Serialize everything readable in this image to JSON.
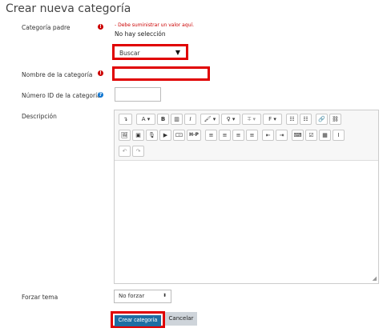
{
  "page": {
    "title": "Crear nueva categoría"
  },
  "form": {
    "parent": {
      "label": "Categoría padre",
      "error": "- Debe suministrar un valor aquí.",
      "current": "No hay selección",
      "search_value": "Buscar"
    },
    "name": {
      "label": "Nombre de la categoría",
      "value": ""
    },
    "idnumber": {
      "label": "Número ID de la categoría",
      "value": ""
    },
    "description": {
      "label": "Descripción",
      "toolbar": {
        "row1": [
          "↴",
          "A ▾",
          "B",
          "▥",
          "I",
          "🖌 ▾",
          "♀ ▾",
          "T̶ ▾",
          "F ▾",
          "☷",
          "☷",
          "🔗",
          "⛓"
        ],
        "row2": [
          "🖼",
          "▣",
          "🎙",
          "▶",
          "🀲",
          "H-P",
          "≡",
          "≡",
          "≡",
          "≡",
          "⇤",
          "⇥",
          "⌨",
          "☑",
          "▦",
          "I"
        ],
        "row3": [
          "↶",
          "↷"
        ]
      }
    },
    "theme": {
      "label": "Forzar tema",
      "value": "No forzar"
    },
    "actions": {
      "create": "Crear categoría",
      "cancel": "Cancelar"
    }
  },
  "colors": {
    "required": "#cc0000",
    "help": "#1177d1",
    "primary": "#1e6ea3",
    "highlight": "#e00000"
  }
}
